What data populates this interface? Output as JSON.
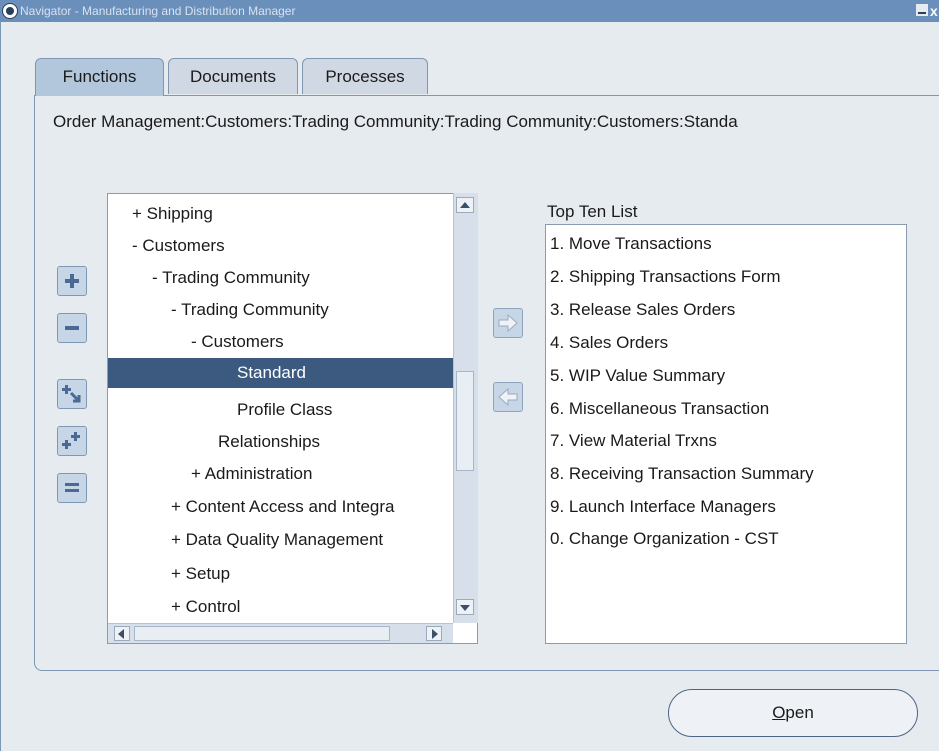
{
  "window": {
    "title": "Navigator - Manufacturing and Distribution Manager",
    "close": "x"
  },
  "tabs": [
    {
      "label": "Functions",
      "active": true
    },
    {
      "label": "Documents",
      "active": false
    },
    {
      "label": "Processes",
      "active": false
    }
  ],
  "path": "Order Management:Customers:Trading Community:Trading Community:Customers:Standa",
  "tree": {
    "items": [
      {
        "label": "+ Shipping",
        "selected": false
      },
      {
        "label": "- Customers",
        "selected": false
      },
      {
        "label": "- Trading Community",
        "selected": false
      },
      {
        "label": "- Trading Community",
        "selected": false
      },
      {
        "label": "- Customers",
        "selected": false
      },
      {
        "label": "Standard",
        "selected": true
      },
      {
        "label": "Profile Class",
        "selected": false
      },
      {
        "label": "Relationships",
        "selected": false
      },
      {
        "label": "+ Administration",
        "selected": false
      },
      {
        "label": "+ Content Access and Integra",
        "selected": false
      },
      {
        "label": "+ Data Quality Management",
        "selected": false
      },
      {
        "label": "+ Setup",
        "selected": false
      },
      {
        "label": "+ Control",
        "selected": false
      }
    ]
  },
  "top_ten": {
    "label": "Top Ten List",
    "items": [
      "1. Move Transactions",
      "2. Shipping Transactions Form",
      "3. Release Sales Orders",
      "4. Sales Orders",
      "5. WIP Value Summary",
      "6. Miscellaneous Transaction",
      "7. View Material Trxns",
      "8. Receiving Transaction Summary",
      "9. Launch Interface Managers",
      "0. Change Organization - CST"
    ]
  },
  "buttons": {
    "open_mnemonic": "O",
    "open_rest": "pen"
  },
  "icons": {
    "expand": "plus-icon",
    "collapse": "minus-icon",
    "expand_branch": "expand-branch-icon",
    "expand_all": "expand-all-icon",
    "collapse_all": "collapse-all-icon",
    "add_to_list": "arrow-right-icon",
    "remove_from_list": "arrow-left-icon"
  },
  "colors": {
    "titlebar": "#6b8fbb",
    "selection": "#3c5a80",
    "background": "#e6ebf0"
  }
}
